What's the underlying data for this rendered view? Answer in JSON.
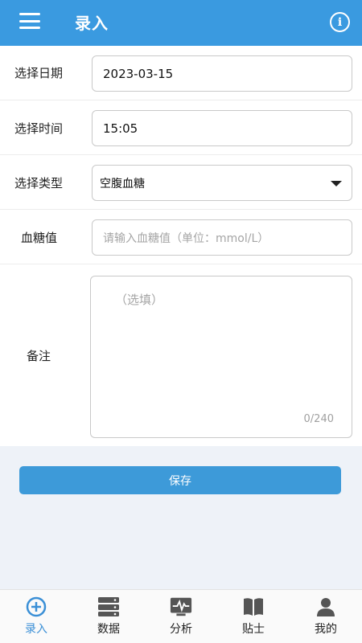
{
  "header": {
    "title": "录入",
    "menu_icon": "menu-icon",
    "info_icon": "info-icon",
    "info_glyph": "i",
    "color": "#3a9ae0"
  },
  "form": {
    "date": {
      "label": "选择日期",
      "value": "2023-03-15"
    },
    "time": {
      "label": "选择时间",
      "value": "15:05"
    },
    "type": {
      "label": "选择类型",
      "value": "空腹血糖"
    },
    "glucose": {
      "label": "血糖值",
      "placeholder": "请输入血糖值（单位：mmol/L）"
    },
    "notes": {
      "label": "备注",
      "placeholder": "（选填）",
      "counter": "0/240"
    }
  },
  "save_button": {
    "label": "保存",
    "color": "#3d9ad9"
  },
  "bottom_nav": {
    "active_color": "#3a8fd6",
    "items": [
      {
        "label": "录入",
        "icon": "add-circle-icon",
        "active": true
      },
      {
        "label": "数据",
        "icon": "database-icon",
        "active": false
      },
      {
        "label": "分析",
        "icon": "analytics-icon",
        "active": false
      },
      {
        "label": "贴士",
        "icon": "book-icon",
        "active": false
      },
      {
        "label": "我的",
        "icon": "user-icon",
        "active": false
      }
    ]
  }
}
